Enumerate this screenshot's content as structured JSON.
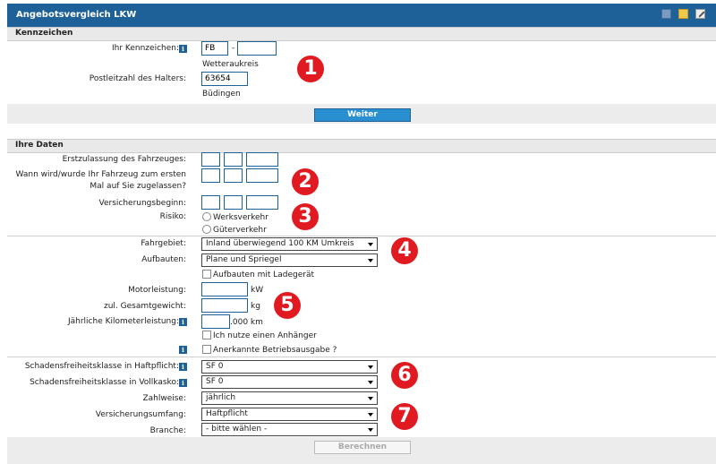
{
  "header": {
    "title": "Angebotsvergleich LKW"
  },
  "kennzeichen": {
    "section_title": "Kennzeichen",
    "kennzeichen_label": "Ihr Kennzeichen:",
    "kennzeichen_part1": "FB",
    "kennzeichen_dash": "-",
    "kennzeichen_part2": "",
    "region": "Wetteraukreis",
    "plz_label": "Postleitzahl des Halters:",
    "plz_value": "63654",
    "city": "Büdingen",
    "weiter_label": "Weiter"
  },
  "ihre_daten": {
    "section_title": "Ihre Daten",
    "erstzulassung_label": "Erstzulassung des Fahrzeuges:",
    "zulassung_label_1": "Wann wird/wurde Ihr Fahrzeug zum ersten",
    "zulassung_label_2": "Mal auf Sie zugelassen?",
    "versicherungsbeginn_label": "Versicherungsbeginn:",
    "risiko_label": "Risiko:",
    "risiko_options": [
      "Werksverkehr",
      "Güterverkehr"
    ],
    "fahrgebiet_label": "Fahrgebiet:",
    "fahrgebiet_value": "Inland überwiegend 100 KM Umkreis",
    "aufbauten_label": "Aufbauten:",
    "aufbauten_value": "Plane und Spriegel",
    "ladegeraet_label": "Aufbauten mit Ladegerät",
    "motorleistung_label": "Motorleistung:",
    "motorleistung_unit": "kW",
    "gesamtgewicht_label": "zul. Gesamtgewicht:",
    "gesamtgewicht_unit": "kg",
    "km_label": "Jährliche Kilometerleistung:",
    "km_unit": ".000 km",
    "anhaenger_label": "Ich nutze einen Anhänger",
    "betriebsausgabe_label": "Anerkannte Betriebsausgabe ?",
    "sf_haftpflicht_label": "Schadensfreiheitsklasse in Haftpflicht:",
    "sf_haftpflicht_value": "SF 0",
    "sf_vollkasko_label": "Schadensfreiheitsklasse in Vollkasko:",
    "sf_vollkasko_value": "SF 0",
    "zahlweise_label": "Zahlweise:",
    "zahlweise_value": "jährlich",
    "umfang_label": "Versicherungsumfang:",
    "umfang_value": "Haftpflicht",
    "branche_label": "Branche:",
    "branche_value": "- bitte wählen -",
    "berechnen_label": "Berechnen"
  },
  "info_glyph": "i",
  "badges": [
    "1",
    "2",
    "3",
    "4",
    "5",
    "6",
    "7"
  ],
  "colors": {
    "header": "#1d6198",
    "badge": "#e11a22",
    "button": "#2a8fd0"
  },
  "icons": [
    "document-icon",
    "folder-icon",
    "edit-icon",
    "info-icon",
    "dropdown-arrow-icon"
  ]
}
